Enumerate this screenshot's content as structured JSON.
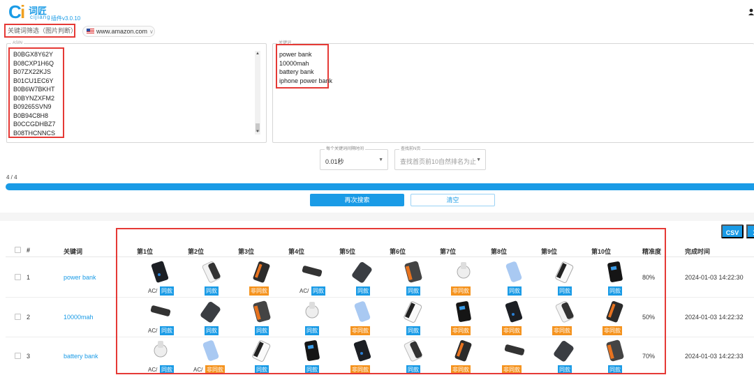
{
  "header": {
    "logo_letters": [
      "C",
      "i"
    ],
    "logo_cn": "词匠",
    "logo_pinyin": "cijiang",
    "version": "插件v3.0.10",
    "user_icon": "user-icon"
  },
  "filters": {
    "mode": "关键词筛选（图片判断）",
    "site": "www.amazon.com",
    "site_flag": "us-flag-icon",
    "site_caret": "∨"
  },
  "asin_box": {
    "legend": "ASIN",
    "items": [
      "B0BGX8Y62Y",
      "B08CXP1H6Q",
      "B07ZX22KJS",
      "B01CU1EC6Y",
      "B0B6W7BKHT",
      "B0BYNZXFM2",
      "B09265SVN9",
      "B0B94C8H8",
      "B0CCGDHBZ7",
      "B08THCNNCS"
    ],
    "scroll_up": "▲",
    "scroll_down": "▼"
  },
  "keyword_box": {
    "legend": "关键词",
    "items": [
      "power bank",
      "10000mah",
      "battery bank",
      "iphone power bank"
    ]
  },
  "interval": {
    "legend": "每个关键词间隔时间",
    "value": "0.01秒",
    "caret": "▼"
  },
  "page_limit": {
    "legend": "查找前N页",
    "value": "查找首页前10自然排名为止",
    "caret": "▼"
  },
  "progress": {
    "text": "4 / 4",
    "fraction": 1.0
  },
  "actions": {
    "search_again": "再次搜索",
    "clear": "清空",
    "csv": "CSV",
    "x": "X"
  },
  "table": {
    "headers": {
      "index": "#",
      "keyword": "关键词",
      "positions": [
        "第1位",
        "第2位",
        "第3位",
        "第4位",
        "第5位",
        "第6位",
        "第7位",
        "第8位",
        "第9位",
        "第10位"
      ],
      "accuracy": "精准度",
      "time": "完成时间"
    },
    "rows": [
      {
        "index": "1",
        "keyword": "power bank",
        "accuracy": "80%",
        "time": "2024-01-03 14:22:30",
        "cells": [
          {
            "ac": "AC/",
            "badge": "同款",
            "type": "same"
          },
          {
            "ac": "",
            "badge": "同款",
            "type": "same"
          },
          {
            "ac": "",
            "badge": "非同款",
            "type": "diff"
          },
          {
            "ac": "AC/",
            "badge": "同款",
            "type": "same"
          },
          {
            "ac": "",
            "badge": "同款",
            "type": "same"
          },
          {
            "ac": "",
            "badge": "同款",
            "type": "same"
          },
          {
            "ac": "",
            "badge": "非同款",
            "type": "diff"
          },
          {
            "ac": "",
            "badge": "同款",
            "type": "same"
          },
          {
            "ac": "",
            "badge": "同款",
            "type": "same"
          },
          {
            "ac": "",
            "badge": "同款",
            "type": "same"
          }
        ]
      },
      {
        "index": "2",
        "keyword": "10000mah",
        "accuracy": "50%",
        "time": "2024-01-03 14:22:32",
        "cells": [
          {
            "ac": "AC/",
            "badge": "同款",
            "type": "same"
          },
          {
            "ac": "",
            "badge": "同款",
            "type": "same"
          },
          {
            "ac": "",
            "badge": "同款",
            "type": "same"
          },
          {
            "ac": "",
            "badge": "同款",
            "type": "same"
          },
          {
            "ac": "",
            "badge": "非同款",
            "type": "diff"
          },
          {
            "ac": "",
            "badge": "同款",
            "type": "same"
          },
          {
            "ac": "",
            "badge": "非同款",
            "type": "diff"
          },
          {
            "ac": "",
            "badge": "非同款",
            "type": "diff"
          },
          {
            "ac": "",
            "badge": "非同款",
            "type": "diff"
          },
          {
            "ac": "",
            "badge": "非同款",
            "type": "diff"
          }
        ]
      },
      {
        "index": "3",
        "keyword": "battery bank",
        "accuracy": "70%",
        "time": "2024-01-03 14:22:33",
        "cells": [
          {
            "ac": "AC/",
            "badge": "同款",
            "type": "same"
          },
          {
            "ac": "AC/",
            "badge": "非同款",
            "type": "diff"
          },
          {
            "ac": "",
            "badge": "同款",
            "type": "same"
          },
          {
            "ac": "",
            "badge": "同款",
            "type": "same"
          },
          {
            "ac": "",
            "badge": "非同款",
            "type": "diff"
          },
          {
            "ac": "",
            "badge": "同款",
            "type": "same"
          },
          {
            "ac": "",
            "badge": "非同款",
            "type": "diff"
          },
          {
            "ac": "",
            "badge": "非同款",
            "type": "diff"
          },
          {
            "ac": "",
            "badge": "同款",
            "type": "same"
          },
          {
            "ac": "",
            "badge": "同款",
            "type": "same"
          }
        ]
      }
    ]
  },
  "colors": {
    "accent": "#1a9be6",
    "same_badge": "#1a9be6",
    "diff_badge": "#f5931e",
    "highlight_frame": "#e53935"
  }
}
